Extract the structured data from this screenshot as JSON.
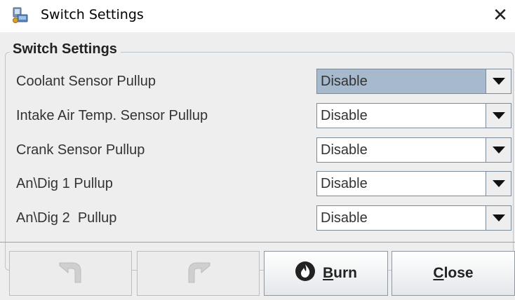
{
  "window": {
    "title": "Switch Settings",
    "close_glyph": "✕",
    "icon": "app-computer-icon"
  },
  "group": {
    "title": "Switch Settings"
  },
  "settings": [
    {
      "label": "Coolant Sensor Pullup",
      "value": "Disable",
      "selected": true
    },
    {
      "label": "Intake Air Temp. Sensor Pullup",
      "value": "Disable",
      "selected": false
    },
    {
      "label": "Crank Sensor Pullup",
      "value": "Disable",
      "selected": false
    },
    {
      "label": "An\\Dig 1 Pullup",
      "value": "Disable",
      "selected": false
    },
    {
      "label": "An\\Dig 2  Pullup",
      "value": "Disable",
      "selected": false
    }
  ],
  "buttons": {
    "undo": {
      "icon": "undo-icon",
      "enabled": false
    },
    "redo": {
      "icon": "redo-icon",
      "enabled": false
    },
    "burn": {
      "mnemonic": "B",
      "rest": "urn",
      "icon": "flame-icon"
    },
    "close": {
      "mnemonic": "C",
      "rest": "lose"
    }
  },
  "colors": {
    "selected_combo": "#a7b9cc",
    "burn_icon": "#222222"
  }
}
